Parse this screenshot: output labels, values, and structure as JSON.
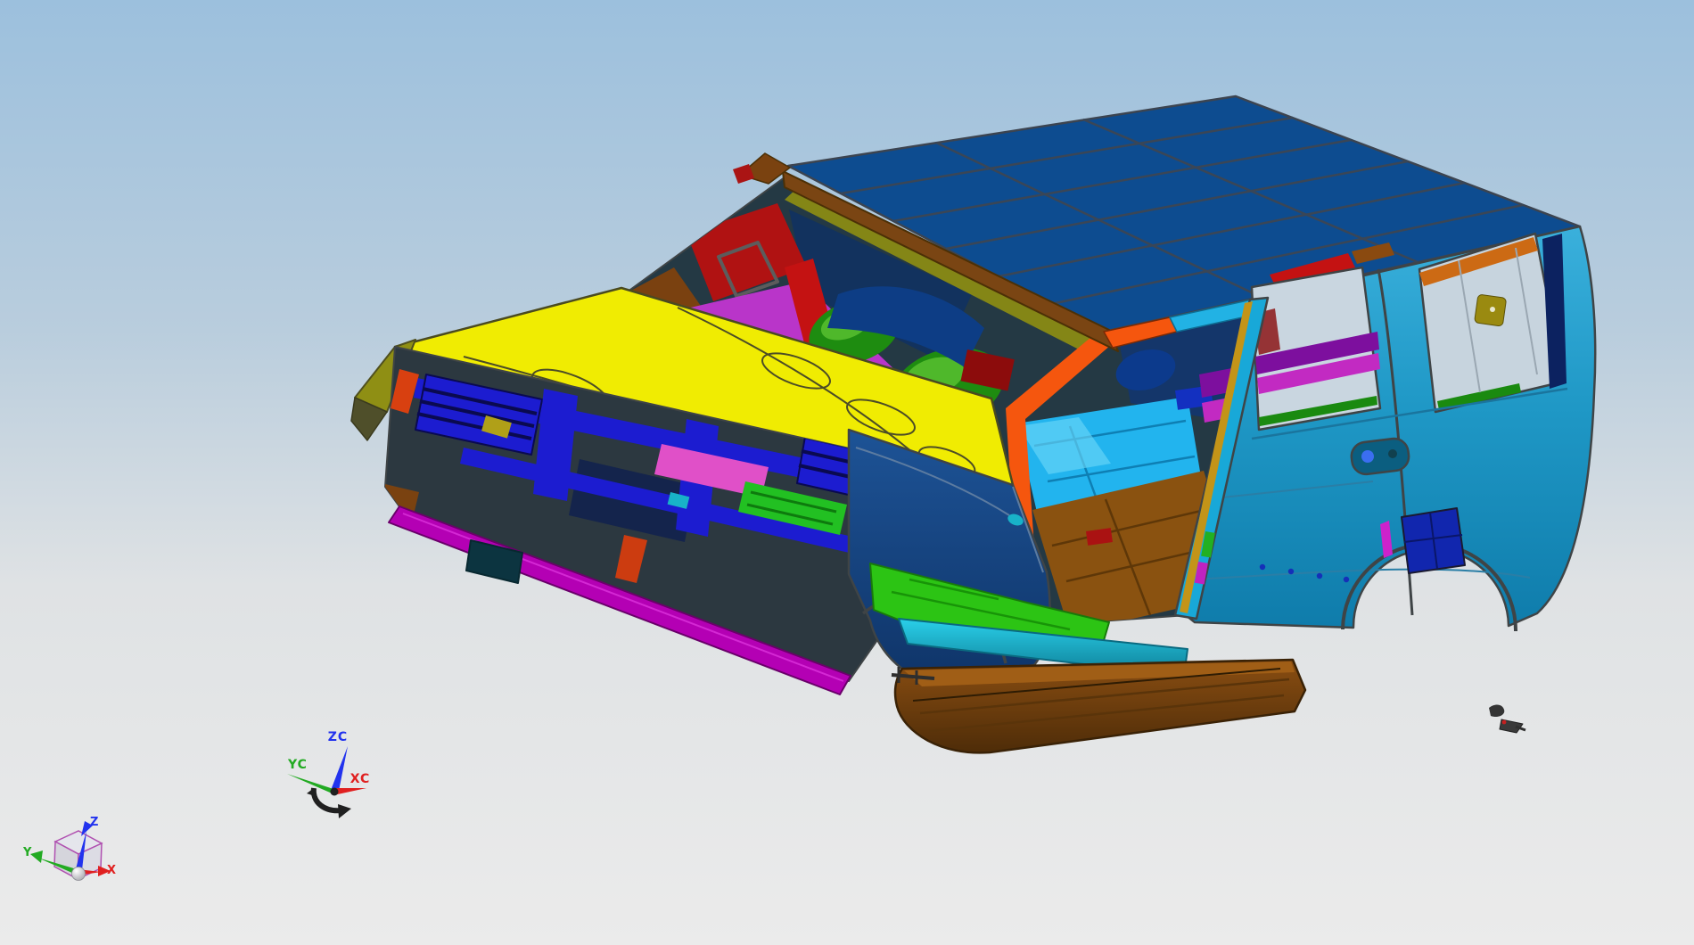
{
  "app": {
    "description": "CAD viewport showing SUV body-in-white assembly, isometric front-left view",
    "background_top": "#9cc0dd",
    "background_mid": "#c7d4de",
    "background_bottom": "#ebebeb"
  },
  "model": {
    "name": "suv-body-in-white",
    "palette": {
      "edge": "#3f4446",
      "roof_blue": "#0d4c90",
      "roof_grid": "#3a4656",
      "header_rail_brown": "#7a4513",
      "hood_yellow": "#f0ec02",
      "hood_line": "#4c4c26",
      "fender_navy": "#16427e",
      "fender_strip_olive": "#8f8f14",
      "bodyside_cyan": "#1f98c6",
      "bodyside_light": "#3ab0dc",
      "rail_orange": "#f5560e",
      "rail_cyan": "#22b2e4",
      "accent_red": "#c41212",
      "bpillar_cyan": "#18a8d8",
      "bpillar_gold": "#c39418",
      "grille_blue": "#1c1cd0",
      "bumper_magenta": "#b400b4",
      "block_teal": "#0c3440",
      "floor_green": "#2cc414",
      "sill_cyan": "#16b8d6",
      "floor_cyan": "#22b4ee",
      "tunnel_brown": "#8a5210",
      "running_board_brown": "#8a4e12",
      "seat_green": "#1e8c10",
      "dash_blue": "#0d3d85",
      "cowl_magenta": "#b935c9",
      "trim_purple": "#7d0f9e",
      "trim_magenta": "#c22ac2",
      "wheel_pocket_blue": "#1126ae",
      "window_trim_orange": "#cc6a14",
      "handle_teal": "#0b5e80",
      "pink_block": "#e050c8",
      "green_block": "#22c022",
      "purple_block": "#8a10a0",
      "debris_gray": "#343434"
    }
  },
  "triads": {
    "wcs": {
      "z_label": "ZC",
      "y_label": "YC",
      "x_label": "XC",
      "z_color": "#2233ee",
      "y_color": "#22aa22",
      "x_color": "#e02020"
    },
    "view": {
      "z_label": "Z",
      "y_label": "Y",
      "x_label": "X",
      "z_color": "#2233ee",
      "y_color": "#22aa22",
      "x_color": "#e02020",
      "cube_edge": "#b050b0"
    }
  }
}
